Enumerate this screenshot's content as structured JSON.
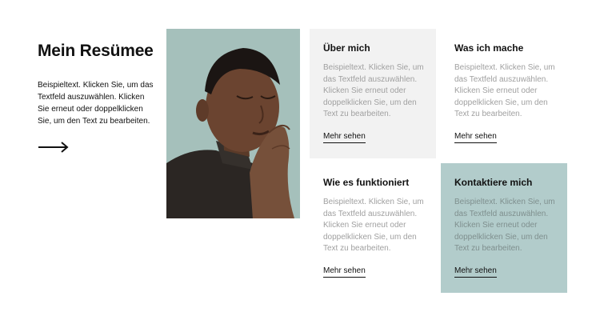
{
  "intro": {
    "title": "Mein Resümee",
    "text": "Beispieltext. Klicken Sie, um das Textfeld auszuwählen. Klicken Sie erneut oder doppelklicken Sie, um den Text zu bearbeiten.",
    "arrow_icon": "arrow-right-icon"
  },
  "photo": {
    "icon": "portrait-photo"
  },
  "cards": [
    {
      "title": "Über mich",
      "text": "Beispieltext. Klicken Sie, um das Textfeld auszuwählen. Klicken Sie erneut oder doppelklicken Sie, um den Text zu bearbeiten.",
      "link": "Mehr sehen",
      "background": "#f2f2f2"
    },
    {
      "title": "Was ich mache",
      "text": "Beispieltext. Klicken Sie, um das Textfeld auszuwählen. Klicken Sie erneut oder doppelklicken Sie, um den Text zu bearbeiten.",
      "link": "Mehr sehen",
      "background": "#ffffff"
    },
    {
      "title": "Wie es funktioniert",
      "text": "Beispieltext. Klicken Sie, um das Textfeld auszuwählen. Klicken Sie erneut oder doppelklicken Sie, um den Text zu bearbeiten.",
      "link": "Mehr sehen",
      "background": "#ffffff"
    },
    {
      "title": "Kontaktiere mich",
      "text": "Beispieltext. Klicken Sie, um das Textfeld auszuwählen. Klicken Sie erneut oder doppelklicken Sie, um den Text zu bearbeiten.",
      "link": "Mehr sehen",
      "background": "#b2cccb"
    }
  ]
}
